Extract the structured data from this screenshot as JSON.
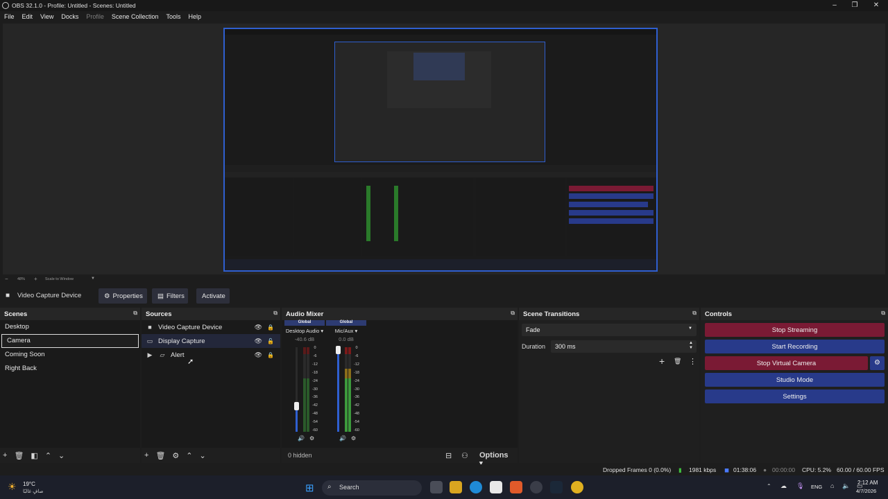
{
  "window": {
    "title": "OBS 32.1.0 - Profile: Untitled - Scenes: Untitled"
  },
  "menu": [
    "File",
    "Edit",
    "View",
    "Docks",
    "Profile",
    "Scene Collection",
    "Tools",
    "Help"
  ],
  "zoom": {
    "level": "48%",
    "mode": "Scale to Window"
  },
  "source_toolbar": {
    "selected_source": "Video Capture Device",
    "properties": "Properties",
    "filters": "Filters",
    "activate": "Activate"
  },
  "scenes": {
    "title": "Scenes",
    "items": [
      "Desktop",
      "Camera",
      "Coming Soon",
      "Right Back"
    ],
    "selected": "Camera"
  },
  "sources": {
    "title": "Sources",
    "items": [
      {
        "label": "Video Capture Device",
        "icon": "camera-icon"
      },
      {
        "label": "Display Capture",
        "icon": "monitor-icon"
      },
      {
        "label": "Alert",
        "icon": "folder-icon"
      }
    ]
  },
  "mixer": {
    "title": "Audio Mixer",
    "channels": [
      {
        "scope": "Global",
        "name": "Desktop Audio",
        "db": "-40.6 dB",
        "volume": 0.3
      },
      {
        "scope": "Global",
        "name": "Mic/Aux",
        "db": "0.0 dB",
        "volume": 1.0
      }
    ],
    "scale": [
      "0",
      "-6",
      "-12",
      "-18",
      "-24",
      "-30",
      "-36",
      "-42",
      "-48",
      "-54",
      "-60"
    ],
    "hidden": "0 hidden",
    "options": "Options"
  },
  "transitions": {
    "title": "Scene Transitions",
    "selected": "Fade",
    "duration_label": "Duration",
    "duration_value": "300 ms"
  },
  "controls": {
    "title": "Controls",
    "stop_streaming": "Stop Streaming",
    "start_recording": "Start Recording",
    "stop_virtual_camera": "Stop Virtual Camera",
    "studio_mode": "Studio Mode",
    "settings": "Settings"
  },
  "status": {
    "dropped": "Dropped Frames 0 (0.0%)",
    "bitrate": "1981 kbps",
    "stream_time": "01:38:06",
    "rec_time": "00:00:00",
    "cpu": "CPU: 5.2%",
    "fps": "60.00 / 60.00 FPS"
  },
  "taskbar": {
    "weather_temp": "19°C",
    "weather_desc": "صافٍ غالبًا",
    "search": "Search",
    "lang": "ENG",
    "time": "2:12 AM",
    "date": "4/7/2026"
  },
  "colors": {
    "accent_red": "#7a1a34",
    "accent_blue": "#283a8a",
    "selection_border": "#2f5fd0"
  }
}
